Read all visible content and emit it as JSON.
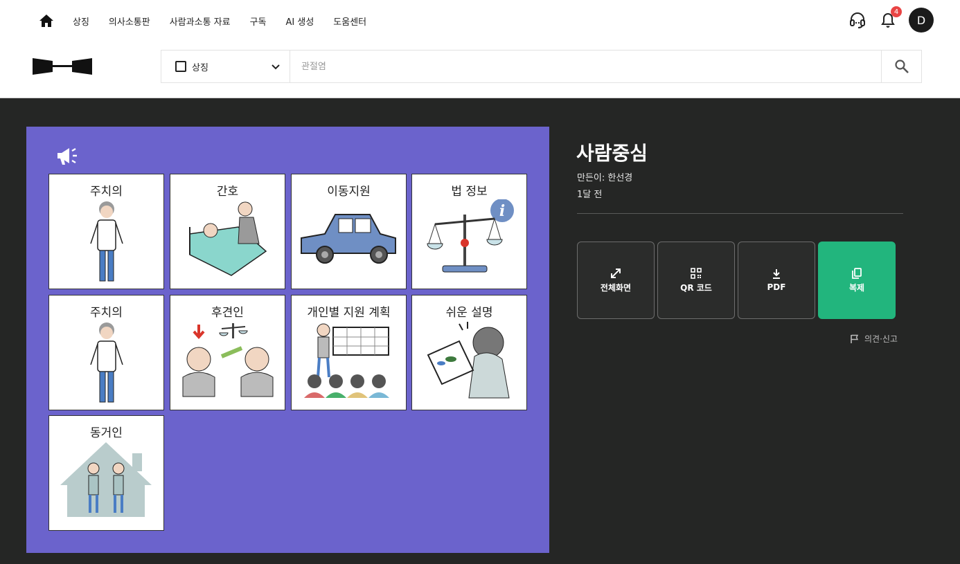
{
  "nav": {
    "items": [
      "상징",
      "의사소통판",
      "사람과소통 자료",
      "구독",
      "AI 생성",
      "도움센터"
    ]
  },
  "notifications": {
    "count": "4"
  },
  "user": {
    "initial": "D"
  },
  "search": {
    "scope_label": "상징",
    "placeholder": "관절염",
    "value": ""
  },
  "board": {
    "background": "#6b63cc",
    "cells": [
      {
        "label": "주치의",
        "icon": "doctor"
      },
      {
        "label": "간호",
        "icon": "nursing"
      },
      {
        "label": "이동지원",
        "icon": "car"
      },
      {
        "label": "법 정보",
        "icon": "scales-info"
      },
      {
        "label": "주치의",
        "icon": "doctor"
      },
      {
        "label": "후견인",
        "icon": "guardian"
      },
      {
        "label": "개인별 지원 계획",
        "icon": "support-plan"
      },
      {
        "label": "쉬운 설명",
        "icon": "easy-read"
      },
      {
        "label": "동거인",
        "icon": "housemate"
      }
    ]
  },
  "detail": {
    "title": "사람중심",
    "author": "만든이: 한선경",
    "time": "1달 전"
  },
  "actions": {
    "fullscreen": "전체화면",
    "qr": "QR 코드",
    "pdf": "PDF",
    "copy": "복제"
  },
  "report_label": "의견·신고",
  "colors": {
    "accent": "#22b57d",
    "board": "#6b63cc",
    "dark_bg": "#252625",
    "badge": "#e94444"
  }
}
